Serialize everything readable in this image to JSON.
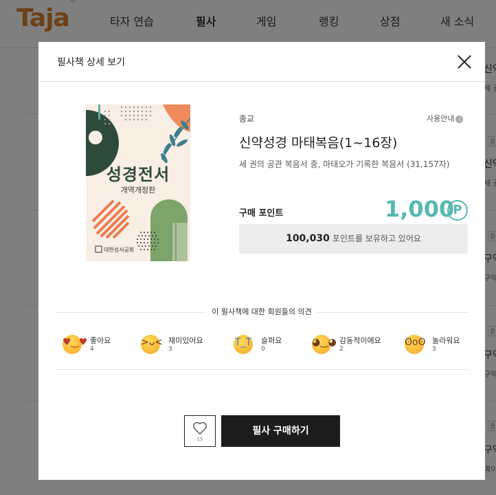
{
  "site": {
    "logo": "Taja",
    "nav": [
      "타자 연습",
      "필사",
      "게임",
      "랭킹",
      "상점",
      "새 소식"
    ]
  },
  "background": {
    "right_texts": [
      "신약",
      "세 권",
      "종",
      "신약",
      "세 권",
      "종",
      "구약",
      "구약",
      "종",
      "구약",
      "구약",
      "종",
      "구약",
      "예이"
    ]
  },
  "modal": {
    "title": "필사책 상세 보기",
    "book": {
      "cover_title": "성경전서",
      "cover_subtitle": "개역개정판",
      "cover_publisher": "대한성서공회",
      "category": "종교",
      "guide_label": "사용안내",
      "title": "신약성경 마태복음(1~16장)",
      "description": "세 권의 공관 복음서 중, 마태오가 기록한 복음서 (31,157자)"
    },
    "purchase": {
      "label": "구매 포인트",
      "price": "1,000",
      "points_owned": "100,030",
      "points_suffix": "포인트를 보유하고 있어요"
    },
    "opinions": {
      "title": "이 필사책에 대한 회원들의 의견",
      "reactions": [
        {
          "label": "좋아요",
          "count": "4",
          "icon": "heart-eyes-emoji-icon"
        },
        {
          "label": "재미있어요",
          "count": "3",
          "icon": "laughing-emoji-icon"
        },
        {
          "label": "슬퍼요",
          "count": "0",
          "icon": "crying-emoji-icon"
        },
        {
          "label": "감동적이에요",
          "count": "2",
          "icon": "touched-emoji-icon"
        },
        {
          "label": "놀라워요",
          "count": "3",
          "icon": "surprised-emoji-icon"
        }
      ]
    },
    "actions": {
      "like_count": "15",
      "buy_label": "필사 구매하기"
    }
  },
  "colors": {
    "accent": "#57b8b2",
    "logo": "#d9802e",
    "button_dark": "#1c1c1c"
  }
}
